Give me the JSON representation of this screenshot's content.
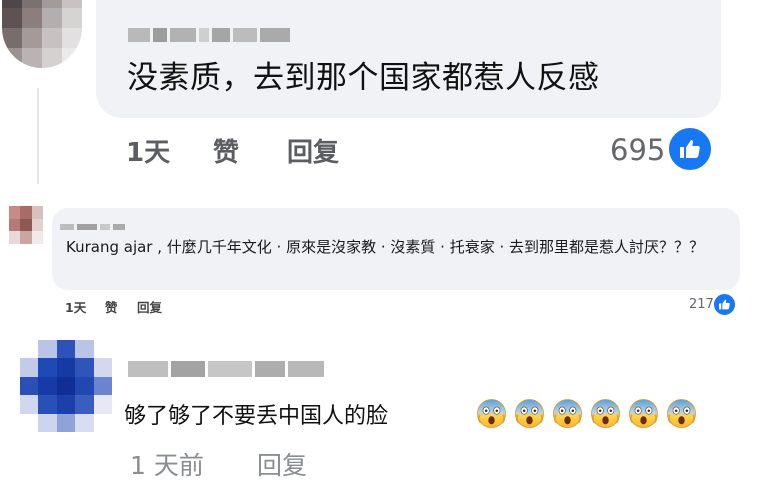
{
  "comments": [
    {
      "text": "没素质，去到那个国家都惹人反感",
      "actions": {
        "time": "1天",
        "like": "赞",
        "reply": "回复"
      },
      "reaction_count": "695",
      "reaction_icon": "thumbs-up-icon"
    },
    {
      "text": "Kurang ajar , 什麼几千年文化 · 原來是沒家教 · 沒素質 · 托衰家 · 去到那里都是惹人討厌？？？",
      "actions": {
        "time": "1天",
        "like": "赞",
        "reply": "回复"
      },
      "reaction_count": "217",
      "reaction_icon": "thumbs-up-icon"
    },
    {
      "text": "够了够了不要丢中国人的脸",
      "emoji": [
        "😱",
        "😱",
        "😱",
        "😱",
        "😱",
        "😱"
      ],
      "actions": {
        "time": "1 天前",
        "reply": "回复"
      }
    }
  ],
  "colors": {
    "bubble_bg": "#f0f2f5",
    "like_blue": "#1877f2",
    "meta_gray": "#65676b"
  }
}
